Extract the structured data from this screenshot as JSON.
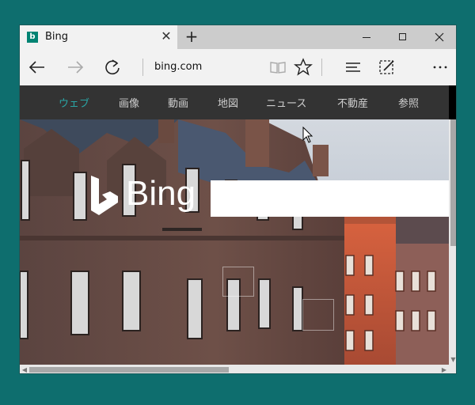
{
  "tab": {
    "title": "Bing",
    "favicon_letter": "b",
    "close_glyph": "✕"
  },
  "new_tab_glyph": "+",
  "address": {
    "url": "bing.com"
  },
  "nav": {
    "items": [
      {
        "label": "ウェブ",
        "active": true
      },
      {
        "label": "画像"
      },
      {
        "label": "動画"
      },
      {
        "label": "地図"
      },
      {
        "label": "ニュース"
      },
      {
        "label": "不動産"
      },
      {
        "label": "参照"
      }
    ]
  },
  "hero": {
    "logo_text": "Bing",
    "search_value": ""
  },
  "colors": {
    "accent": "#008373",
    "nav_bg": "#333333",
    "nav_active": "#2aa5a5",
    "desktop": "#0e6e6e"
  },
  "icons": [
    "back-arrow-icon",
    "forward-arrow-icon",
    "refresh-icon",
    "reading-view-icon",
    "favorite-star-icon",
    "hub-icon",
    "web-note-icon",
    "more-icon"
  ]
}
